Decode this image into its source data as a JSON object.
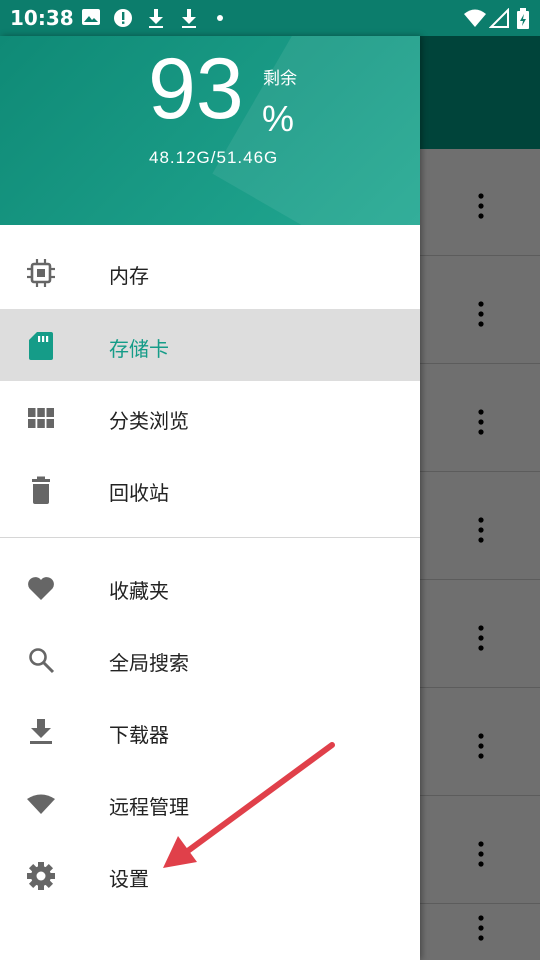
{
  "status_bar": {
    "time": "10:38",
    "icons": [
      "image-icon",
      "alert-icon",
      "download-icon",
      "download-icon",
      "dot-icon",
      "wifi-icon",
      "signal-icon",
      "battery-icon"
    ]
  },
  "drawer": {
    "header": {
      "percent": "93",
      "remain_label": "剩余",
      "percent_sign": "%",
      "usage": "48.12G/51.46G",
      "background_color": "#1a9c86"
    },
    "menu_items": [
      {
        "label": "内存",
        "icon": "chip-icon",
        "active": false
      },
      {
        "label": "存储卡",
        "icon": "sd-card-icon",
        "active": true
      },
      {
        "label": "分类浏览",
        "icon": "grid-icon",
        "active": false
      },
      {
        "label": "回收站",
        "icon": "trash-icon",
        "active": false
      },
      {
        "label": "收藏夹",
        "icon": "heart-icon",
        "active": false
      },
      {
        "label": "全局搜索",
        "icon": "search-icon",
        "active": false
      },
      {
        "label": "下载器",
        "icon": "download-icon",
        "active": false
      },
      {
        "label": "远程管理",
        "icon": "wifi-icon",
        "active": false
      },
      {
        "label": "设置",
        "icon": "gear-icon",
        "active": false
      }
    ],
    "accent_color": "#159c88"
  },
  "annotation": {
    "arrow_color": "#e0404a",
    "points_to": "settings"
  }
}
